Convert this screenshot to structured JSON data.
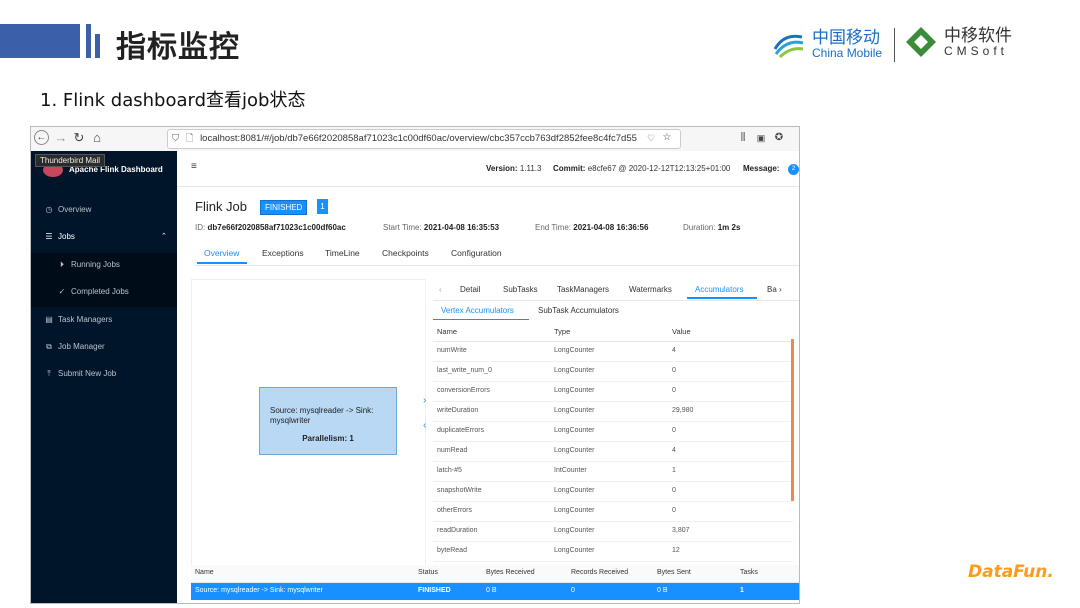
{
  "slide": {
    "title": "指标监控",
    "subtitle": "1. Flink dashboard查看job状态",
    "logo_cm_cn": "中国移动",
    "logo_cm_en": "China Mobile",
    "logo_cms_cn": "中移软件",
    "logo_cms_en": "CMSoft",
    "footer_logo": "DataFun."
  },
  "browser": {
    "url": "localhost:8081/#/job/db7e66f2020858af71023c1c00df60ac/overview/cbc357ccb763df2852fee8c4fc7d55"
  },
  "sidebar": {
    "tooltip": "Thunderbird Mail",
    "app_title": "Apache Flink Dashboard",
    "items": [
      {
        "label": "Overview",
        "icon": "dashboard-icon"
      },
      {
        "label": "Jobs",
        "icon": "list-icon"
      },
      {
        "label": "Running Jobs",
        "icon": "play-circle-icon"
      },
      {
        "label": "Completed Jobs",
        "icon": "check-circle-icon"
      },
      {
        "label": "Task Managers",
        "icon": "schedule-icon"
      },
      {
        "label": "Job Manager",
        "icon": "cluster-icon"
      },
      {
        "label": "Submit New Job",
        "icon": "upload-icon"
      }
    ]
  },
  "topbar": {
    "version_label": "Version:",
    "version": "1.11.3",
    "commit_label": "Commit:",
    "commit": "e8cfe67 @ 2020-12-12T12:13:25+01:00",
    "message_label": "Message:",
    "message_count": "2"
  },
  "job": {
    "name": "Flink Job",
    "status": "FINISHED",
    "parallel_badge": "1",
    "id_label": "ID:",
    "id": "db7e66f2020858af71023c1c00df60ac",
    "start_label": "Start Time:",
    "start": "2021-04-08 16:35:53",
    "end_label": "End Time:",
    "end": "2021-04-08 16:36:56",
    "duration_label": "Duration:",
    "duration": "1m 2s"
  },
  "tabs": [
    "Overview",
    "Exceptions",
    "TimeLine",
    "Checkpoints",
    "Configuration"
  ],
  "graph": {
    "node_title": "Source: mysqlreader -> Sink: mysqlwriter",
    "node_parallelism": "Parallelism: 1"
  },
  "detail_tabs": [
    "Detail",
    "SubTasks",
    "TaskManagers",
    "Watermarks",
    "Accumulators",
    "Ba"
  ],
  "sub_tabs": [
    "Vertex Accumulators",
    "SubTask Accumulators"
  ],
  "accumulators": {
    "headers": [
      "Name",
      "Type",
      "Value"
    ],
    "rows": [
      [
        "numWrite",
        "LongCounter",
        "4"
      ],
      [
        "last_write_num_0",
        "LongCounter",
        "0"
      ],
      [
        "conversionErrors",
        "LongCounter",
        "0"
      ],
      [
        "writeDuration",
        "LongCounter",
        "29,980"
      ],
      [
        "duplicateErrors",
        "LongCounter",
        "0"
      ],
      [
        "numRead",
        "LongCounter",
        "4"
      ],
      [
        "latch-#5",
        "IntCounter",
        "1"
      ],
      [
        "snapshotWrite",
        "LongCounter",
        "0"
      ],
      [
        "otherErrors",
        "LongCounter",
        "0"
      ],
      [
        "readDuration",
        "LongCounter",
        "3,807"
      ],
      [
        "byteRead",
        "LongCounter",
        "12"
      ]
    ]
  },
  "vertex_table": {
    "headers": [
      "Name",
      "Status",
      "Bytes Received",
      "Records Received",
      "Bytes Sent",
      "Tasks"
    ],
    "row": [
      "Source: mysqlreader -> Sink: mysqlwriter",
      "FINISHED",
      "0 B",
      "0",
      "0 B",
      "1"
    ]
  },
  "colors": {
    "accent": "#1890ff",
    "sidebar": "#001529",
    "slide_blue": "#3b5fa8",
    "datafun": "#ff9a1f"
  }
}
